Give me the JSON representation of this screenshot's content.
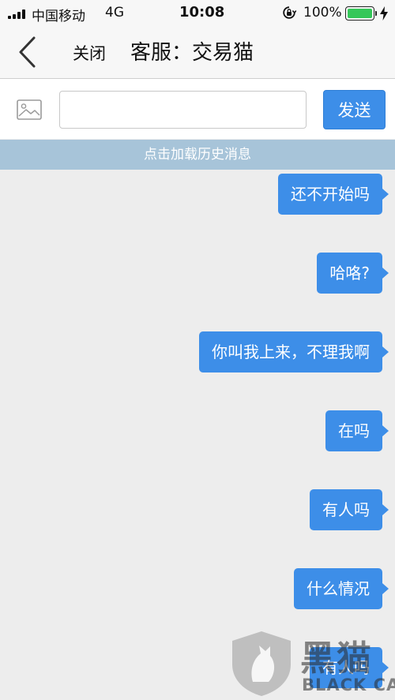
{
  "status_bar": {
    "carrier": "中国移动",
    "network": "4G",
    "time": "10:08",
    "battery_percent": "100%",
    "battery_level": 1.0,
    "battery_color": "#35c759"
  },
  "nav": {
    "back_icon": "chevron-left-icon",
    "close_label": "关闭",
    "title": "客服：交易猫"
  },
  "input_bar": {
    "image_icon": "image-icon",
    "input_value": "",
    "input_placeholder": "",
    "send_label": "发送"
  },
  "load_history_label": "点击加载历史消息",
  "messages": [
    {
      "text": "还不开始吗"
    },
    {
      "text": "哈咯?"
    },
    {
      "text": "你叫我上来，不理我啊"
    },
    {
      "text": "在吗"
    },
    {
      "text": "有人吗"
    },
    {
      "text": "什么情况"
    },
    {
      "text": "有人吗"
    }
  ],
  "watermark": {
    "logo_text": "黑猫",
    "english_text": "BLACK CAT"
  },
  "colors": {
    "accent": "#3d8ee8",
    "history_bar": "#a7c4d9",
    "chat_background": "#ededed"
  }
}
